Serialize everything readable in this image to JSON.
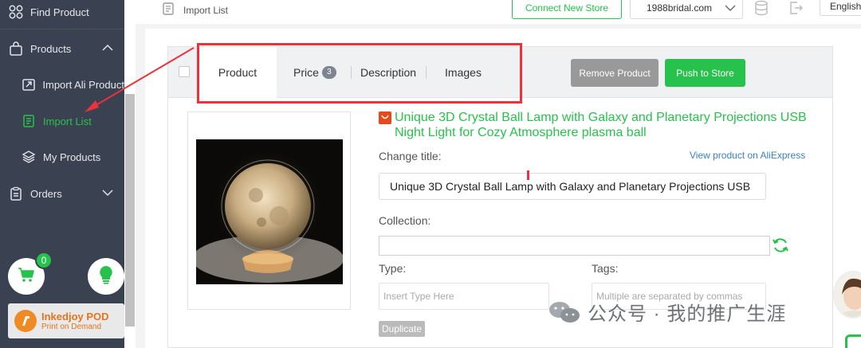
{
  "sidebar": {
    "items": [
      {
        "label": "Find Product"
      },
      {
        "label": "Products"
      },
      {
        "label": "Import Ali Product"
      },
      {
        "label": "Import List"
      },
      {
        "label": "My Products"
      },
      {
        "label": "Orders"
      }
    ],
    "cart_count": "0",
    "pod": {
      "title": "Inkedjoy POD",
      "subtitle": "Print on Demand"
    }
  },
  "topbar": {
    "page_title": "Import List",
    "connect_label": "Connect New Store",
    "store_value": "1988bridal.com",
    "language": "English"
  },
  "product_card": {
    "tabs": [
      {
        "label": "Product",
        "active": true
      },
      {
        "label": "Price",
        "badge": "3"
      },
      {
        "label": "Description"
      },
      {
        "label": "Images"
      }
    ],
    "remove_label": "Remove Product",
    "push_label": "Push to Store",
    "title": "Unique 3D Crystal Ball Lamp with Galaxy and Planetary Projections USB Night Light for Cozy Atmosphere plasma ball",
    "change_title_label": "Change title:",
    "view_link": "View product on AliExpress",
    "title_value": "Unique 3D Crystal Ball Lamp with Galaxy and Planetary Projections USB",
    "collection_label": "Collection:",
    "type_label": "Type:",
    "type_placeholder": "Insert Type Here",
    "tags_label": "Tags:",
    "tags_placeholder": "Multiple are separated by commas",
    "duplicate_label": "Duplicate"
  },
  "watermark": {
    "text": "公众号 · 我的推广生涯"
  },
  "colors": {
    "accent": "#27c24c",
    "sidebar_bg": "#3a4150",
    "annotation": "#e8343a",
    "link": "#3a82c4"
  }
}
